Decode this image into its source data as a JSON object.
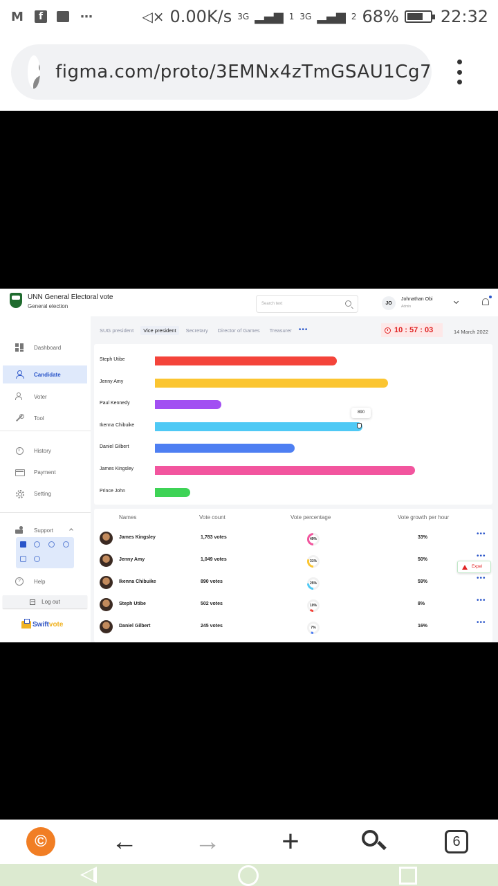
{
  "status_bar": {
    "net_speed": "0.00K/s",
    "net1": "3G",
    "net2": "3G",
    "sim1": "1",
    "sim2": "2",
    "battery_percent_label": "68%",
    "battery_level": 0.68,
    "time": "22:32",
    "dots": "⋯"
  },
  "browser": {
    "url": "figma.com/proto/3EMNx4zTmGSAU1Cg7",
    "tab_count": "6"
  },
  "app": {
    "title": "UNN General Electoral vote",
    "subtitle": "General election",
    "search_placeholder": "Search text",
    "user": {
      "initials": "JO",
      "name": "Johnathan Obi",
      "role": "Admin"
    },
    "brand_main": "Swift",
    "brand_accent": "vote"
  },
  "sidebar": {
    "items": [
      {
        "label": "Dashboard"
      },
      {
        "label": "Candidate"
      },
      {
        "label": "Voter"
      },
      {
        "label": "Tool"
      },
      {
        "label": "History"
      },
      {
        "label": "Payment"
      },
      {
        "label": "Setting"
      },
      {
        "label": "Support"
      },
      {
        "label": "Help"
      }
    ],
    "logout_label": "Log out"
  },
  "tabs": [
    {
      "label": "SUG president"
    },
    {
      "label": "Vice president"
    },
    {
      "label": "Secretary"
    },
    {
      "label": "Director of Games"
    },
    {
      "label": "Treasurer"
    }
  ],
  "timer": "10 : 57 : 03",
  "date": "14 March 2022",
  "chart_data": {
    "type": "bar",
    "orientation": "horizontal",
    "categories": [
      "Steph Utibe",
      "Jenny Amy",
      "Paul Kennedy",
      "Ikenna Chibuike",
      "Daniel Gilbert",
      "James Kingsley",
      "Prince John"
    ],
    "values": [
      780,
      1000,
      285,
      890,
      600,
      1115,
      150
    ],
    "colors": [
      "#f4443a",
      "#fbc531",
      "#a24ff2",
      "#4fc9f5",
      "#4e7ff2",
      "#f2559e",
      "#3ed356"
    ],
    "tooltip": {
      "category": "Ikenna Chibuike",
      "label": "890"
    },
    "xlim": [
      0,
      1400
    ],
    "grid": false
  },
  "table": {
    "headers": [
      "Names",
      "Vote count",
      "Vote percentage",
      "Vote growth per hour"
    ],
    "rows": [
      {
        "name": "James Kingsley",
        "votes": "1,783 votes",
        "percent_label": "49%",
        "percent": 49,
        "color": "#f2559e",
        "growth": "33%"
      },
      {
        "name": "Jenny Amy",
        "votes": "1,049 votes",
        "percent_label": "31%",
        "percent": 31,
        "color": "#fbc531",
        "growth": "50%"
      },
      {
        "name": "Ikenna Chibuike",
        "votes": "890 votes",
        "percent_label": "25%",
        "percent": 25,
        "color": "#4fc9f5",
        "growth": "59%"
      },
      {
        "name": "Steph Utibe",
        "votes": "502 votes",
        "percent_label": "10%",
        "percent": 10,
        "color": "#f4443a",
        "growth": "8%"
      },
      {
        "name": "Daniel Gilbert",
        "votes": "245 votes",
        "percent_label": "7%",
        "percent": 7,
        "color": "#4e7ff2",
        "growth": "16%"
      }
    ],
    "expel_label": "Expel"
  }
}
